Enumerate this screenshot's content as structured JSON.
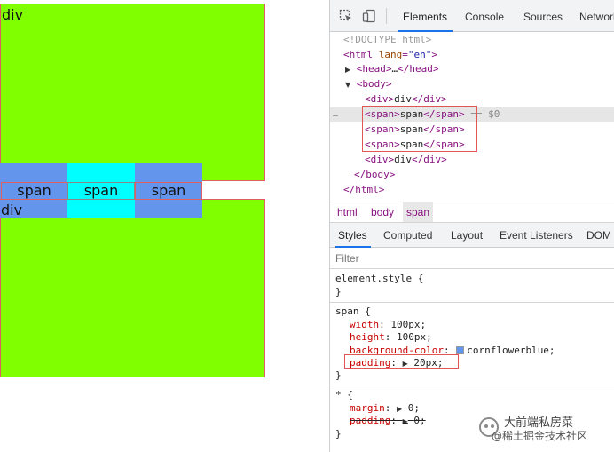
{
  "rendered_page": {
    "divs": [
      "div",
      "div"
    ],
    "spans": [
      {
        "text": "span",
        "color": "#6495ed"
      },
      {
        "text": "span",
        "color": "#00ffff"
      },
      {
        "text": "span",
        "color": "#6495ed"
      }
    ],
    "div_color": "#80ff00"
  },
  "devtools": {
    "toolbar_icons": [
      "inspect-cursor-icon",
      "device-toggle-icon"
    ],
    "tabs": [
      "Elements",
      "Console",
      "Sources",
      "Network"
    ],
    "active_tab": "Elements",
    "dom": {
      "doctype": "<!DOCTYPE html>",
      "html_open": "html",
      "lang_attr": "lang",
      "lang_value": "\"en\"",
      "head_collapsed": "…",
      "head_tag": "head",
      "body_tag": "body",
      "div_tag": "div",
      "div_text": "div",
      "span_tag": "span",
      "span_text": "span",
      "selected_marker": "== $0",
      "ellipsis": "…"
    },
    "breadcrumbs": [
      "html",
      "body",
      "span"
    ],
    "subtabs": [
      "Styles",
      "Computed",
      "Layout",
      "Event Listeners",
      "DOM"
    ],
    "active_subtab": "Styles",
    "filter_placeholder": "Filter",
    "rules": {
      "element_style": "element.style {",
      "close": "}",
      "span_selector": "span {",
      "span_props": [
        {
          "name": "width",
          "value": "100px;"
        },
        {
          "name": "height",
          "value": "100px;"
        },
        {
          "name": "background-color",
          "value": "cornflowerblue;"
        },
        {
          "name": "padding",
          "value": "20px;"
        }
      ],
      "swatch_color": "#6495ed",
      "universal_selector": "* {",
      "universal_props": [
        {
          "name": "margin",
          "value": "0;"
        },
        {
          "name": "padding",
          "value": "0;"
        }
      ]
    },
    "highlight_color": "#e25555"
  },
  "watermark": {
    "line1": "大前端私房菜",
    "line2": "@稀土掘金技术社区"
  }
}
